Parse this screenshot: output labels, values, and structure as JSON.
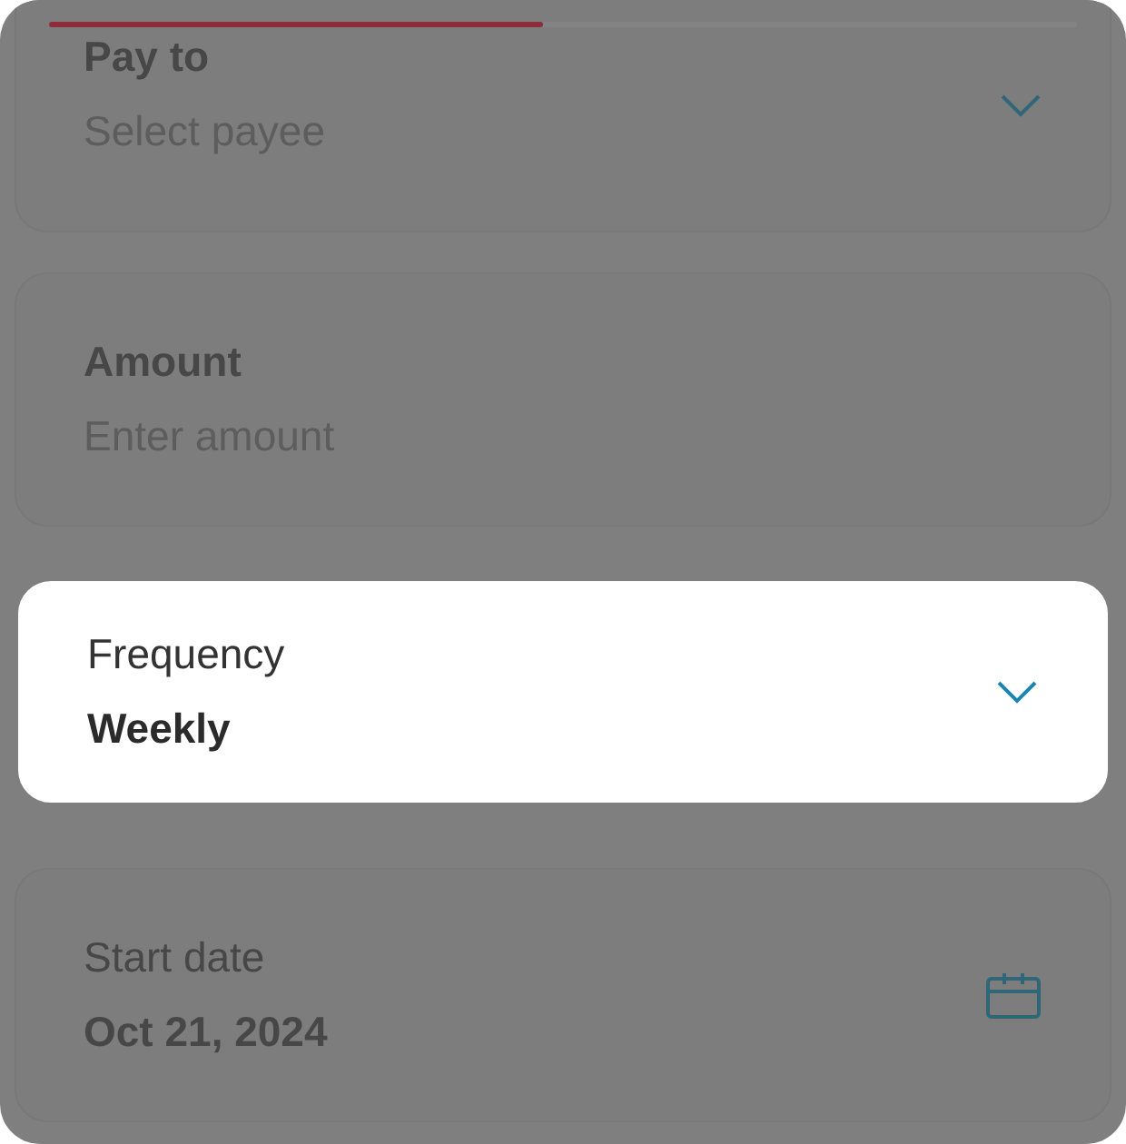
{
  "progress": {
    "level": 0.48
  },
  "fields": [
    {
      "kind": "dropdown",
      "label": "Pay to",
      "placeholder": "Select payee",
      "highlighted": false
    },
    {
      "kind": "text",
      "label": "Amount",
      "placeholder": "Enter amount",
      "highlighted": false
    },
    {
      "kind": "dropdown",
      "label": "Frequency",
      "value": "Weekly",
      "highlighted": true
    },
    {
      "kind": "date",
      "label": "Start date",
      "value": "Oct 21, 2024",
      "highlighted": false
    }
  ]
}
